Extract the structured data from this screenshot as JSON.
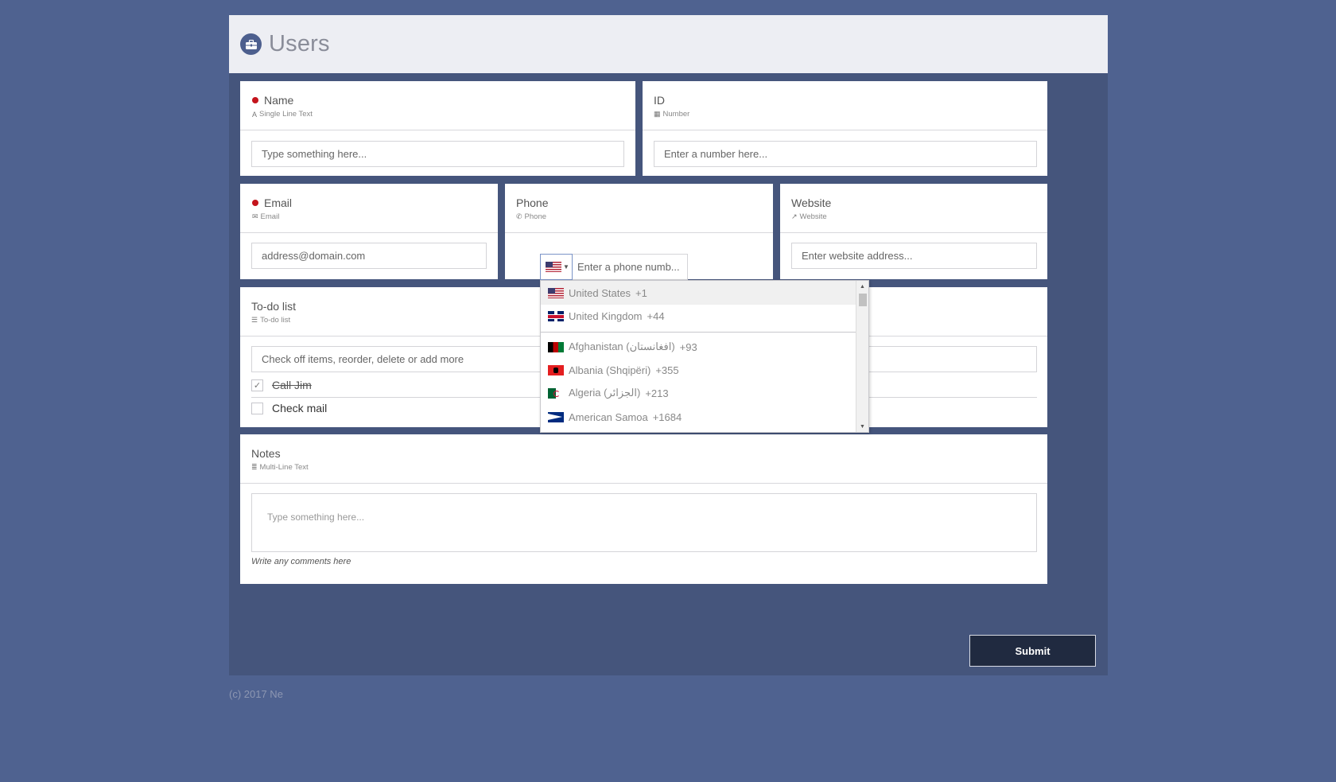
{
  "header": {
    "title": "Users",
    "icon": "briefcase-icon"
  },
  "fields": {
    "name": {
      "label": "Name",
      "type": "Single Line Text",
      "placeholder": "Type something here...",
      "required": true
    },
    "id": {
      "label": "ID",
      "type": "Number",
      "placeholder": "Enter a number here..."
    },
    "email": {
      "label": "Email",
      "type": "Email",
      "placeholder": "address@domain.com",
      "required": true
    },
    "phone": {
      "label": "Phone",
      "type": "Phone",
      "placeholder": "Enter a phone numb..."
    },
    "website": {
      "label": "Website",
      "type": "Website",
      "placeholder": "Enter website address..."
    },
    "todo": {
      "label": "To-do list",
      "type": "To-do list",
      "placeholder": "Check off items, reorder, delete or add more",
      "items": [
        {
          "text": "Call Jim",
          "checked": true
        },
        {
          "text": "Check mail",
          "checked": false
        }
      ]
    },
    "notes": {
      "label": "Notes",
      "type": "Multi-Line Text",
      "placeholder": "Type something here...",
      "help": "Write any comments here"
    }
  },
  "phone_dropdown": {
    "selected_flag": "us-flag-icon",
    "items": [
      {
        "flag": "us-flag-icon",
        "name": "United States",
        "code": "+1",
        "highlighted": true
      },
      {
        "flag": "uk-flag-icon",
        "name": "United Kingdom",
        "code": "+44"
      },
      {
        "flag": "af-flag-icon",
        "name": "Afghanistan (‫افغانستان‬‎)",
        "code": "+93"
      },
      {
        "flag": "al-flag-icon",
        "name": "Albania (Shqipëri)",
        "code": "+355"
      },
      {
        "flag": "dz-flag-icon",
        "name": "Algeria (‫الجزائر‬‎)",
        "code": "+213"
      },
      {
        "flag": "as-flag-icon",
        "name": "American Samoa",
        "code": "+1684"
      }
    ]
  },
  "submit_label": "Submit",
  "footer": "(c) 2017 Ne",
  "colors": {
    "background": "#4f6290",
    "panel": "#45557c",
    "required": "#c4141c",
    "submit": "#202a40"
  }
}
